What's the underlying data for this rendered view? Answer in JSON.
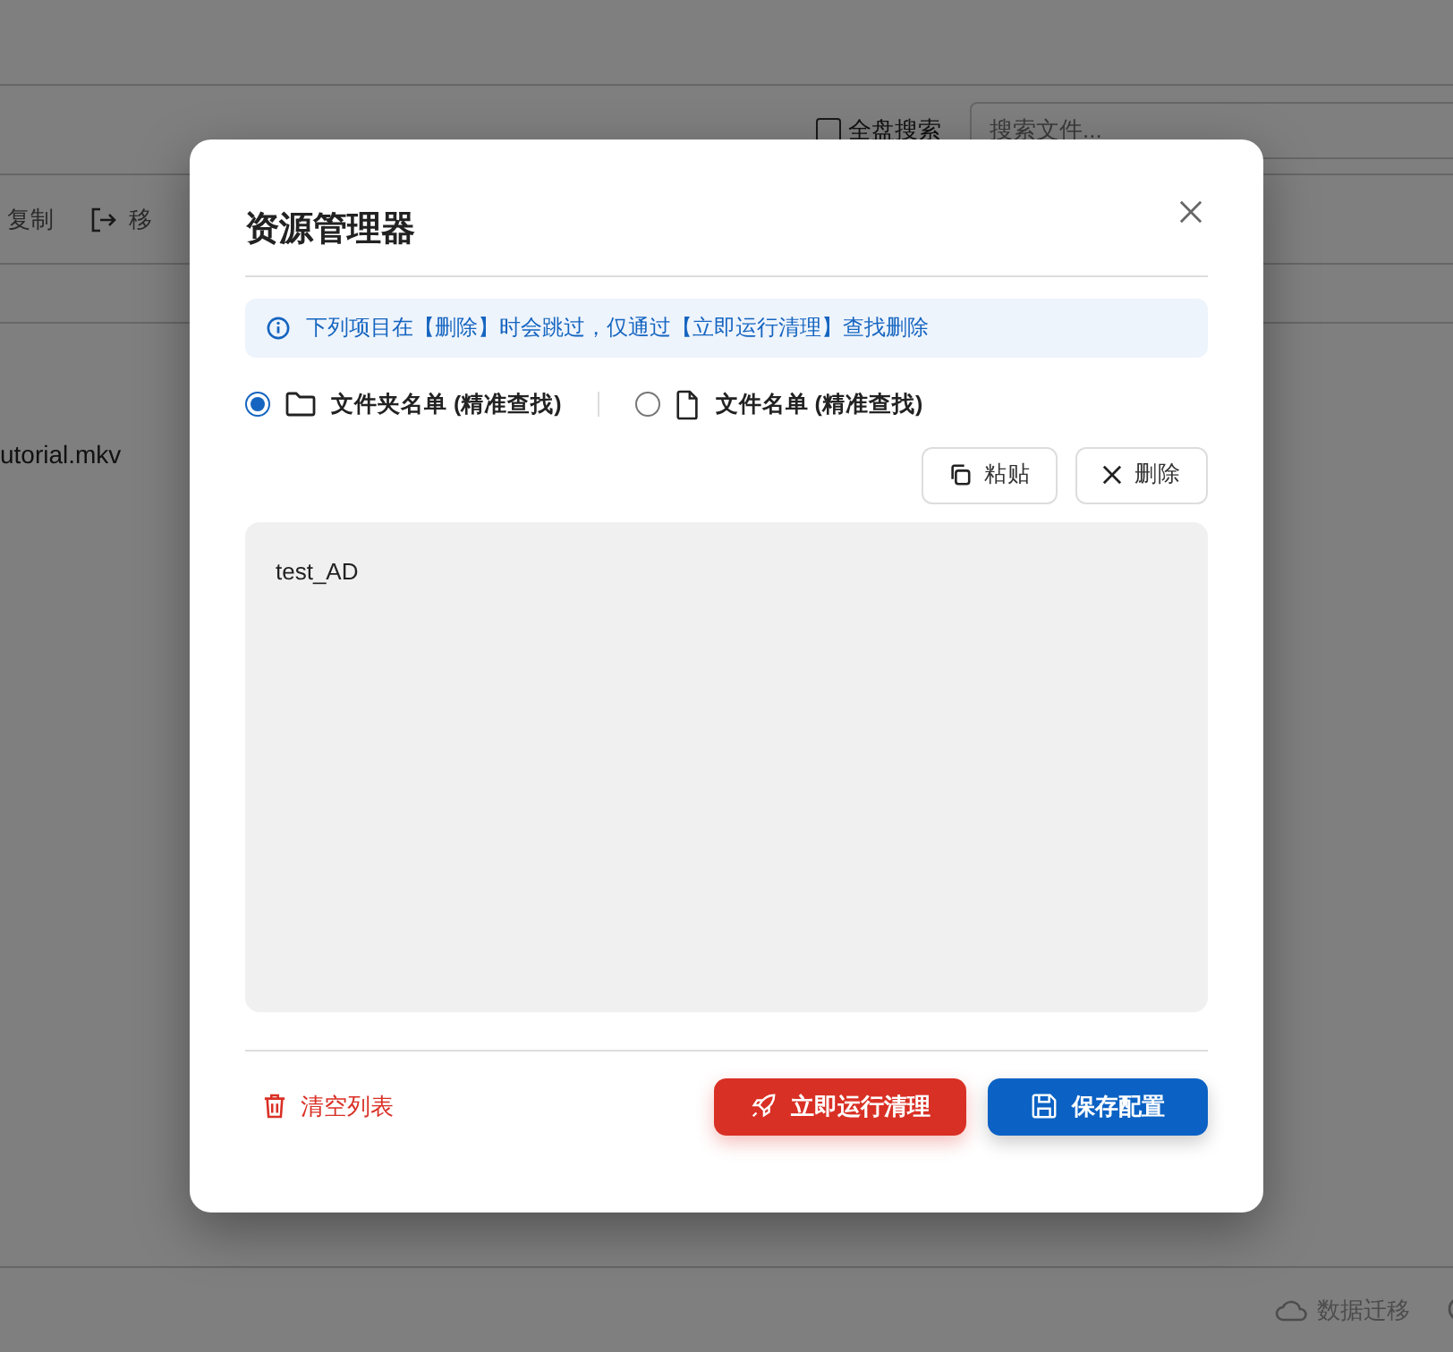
{
  "background": {
    "global_search": {
      "label": "全盘搜索",
      "checked": false
    },
    "search": {
      "placeholder": "搜索文件..."
    },
    "actions": [
      {
        "kind": "copy",
        "label": "复制"
      },
      {
        "kind": "move",
        "label": "移"
      }
    ],
    "file_name": "utorial.mkv",
    "status_bar": {
      "migrate": "数据迁移"
    }
  },
  "dialog": {
    "title": "资源管理器",
    "notice": "下列项目在【删除】时会跳过，仅通过【立即运行清理】查找删除",
    "list_types": [
      {
        "kind": "folder",
        "label": "文件夹名单 (精准查找)",
        "selected": true
      },
      {
        "kind": "file",
        "label": "文件名单 (精准查找)",
        "selected": false
      }
    ],
    "tools": [
      {
        "kind": "paste",
        "label": "粘贴"
      },
      {
        "kind": "delete",
        "label": "删除"
      }
    ],
    "entries": [
      "test_AD"
    ],
    "clear_button": "清空列表",
    "run_button": "立即运行清理",
    "save_button": "保存配置"
  }
}
